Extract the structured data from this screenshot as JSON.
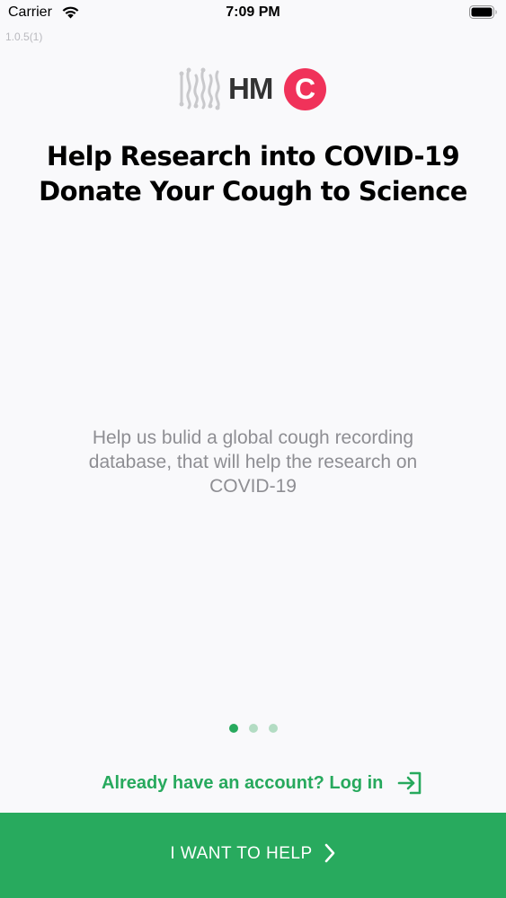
{
  "status_bar": {
    "carrier": "Carrier",
    "time": "7:09 PM",
    "wifi_icon": "wifi-icon",
    "battery_icon": "battery-icon"
  },
  "app": {
    "version": "1.0.5(1)",
    "logo_text": "HM",
    "logo_badge": "C"
  },
  "onboarding": {
    "headline_line1": "Help Research into COVID-19",
    "headline_line2": "Donate Your Cough to Science",
    "subtitle": "Help us bulid a global cough recording database, that will help the research on COVID-19",
    "page_indicator": {
      "count": 3,
      "current": 1
    }
  },
  "actions": {
    "login_link": "Already have an account? Log in",
    "login_icon": "login-arrow-icon",
    "primary_button": "I WANT TO HELP",
    "primary_button_icon": "chevron-right-icon"
  },
  "colors": {
    "accent_green": "#28aa5e",
    "logo_red": "#f0325a",
    "subtitle_gray": "#8e8e93"
  }
}
